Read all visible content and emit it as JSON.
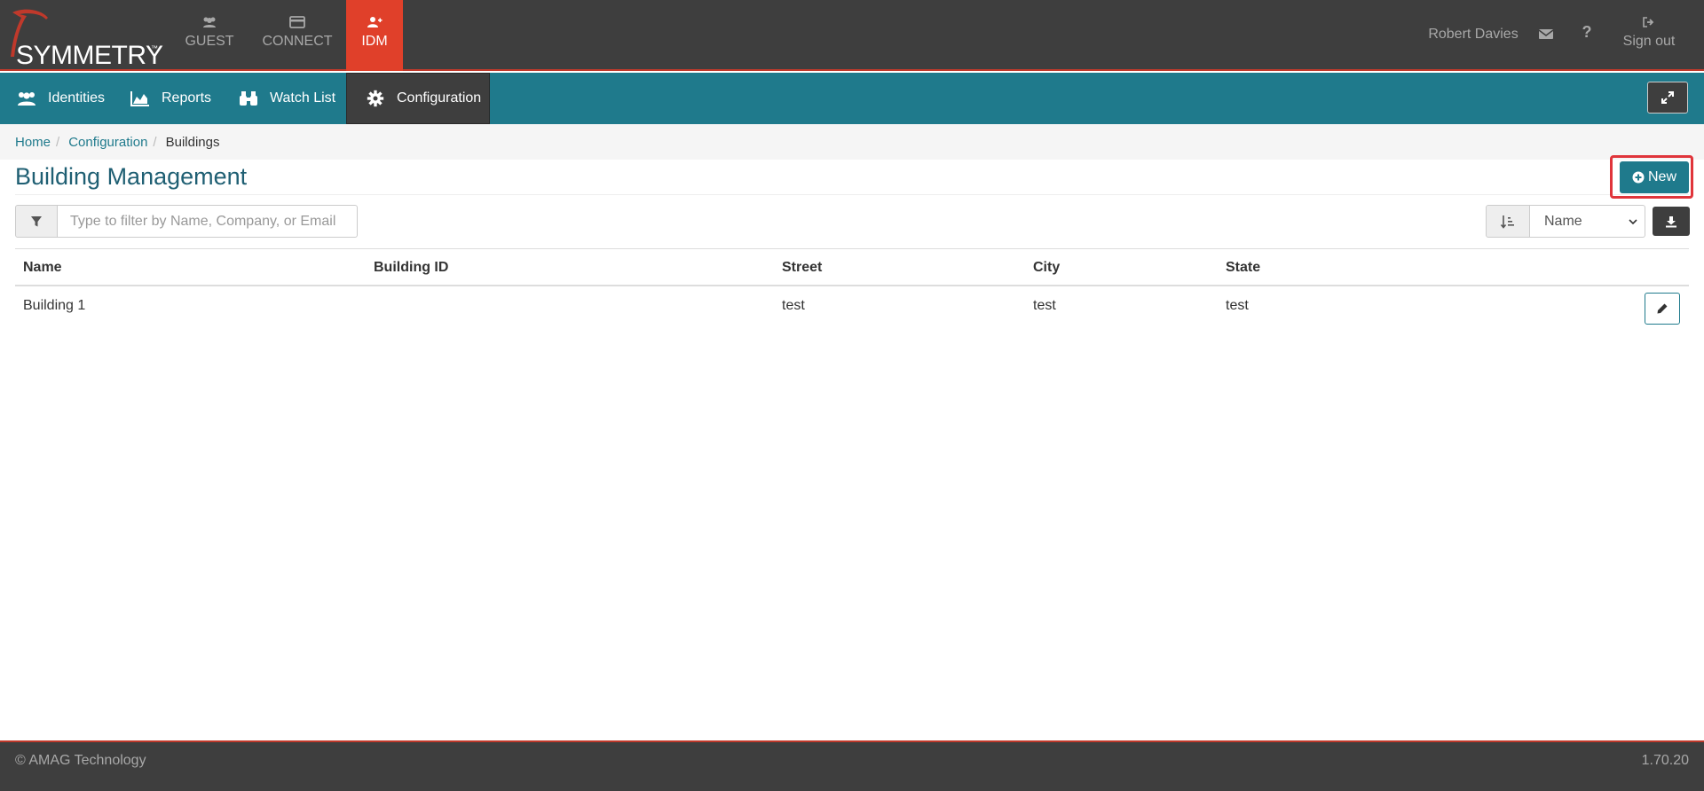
{
  "brand": {
    "name": "SYMMETRY",
    "tm": "™"
  },
  "app_tabs": [
    {
      "label": "GUEST",
      "icon": "users-icon",
      "active": false
    },
    {
      "label": "CONNECT",
      "icon": "card-icon",
      "active": false
    },
    {
      "label": "IDM",
      "icon": "user-plus-icon",
      "active": true
    }
  ],
  "user": {
    "name": "Robert Davies",
    "sign_out": "Sign out"
  },
  "nav": {
    "identities": "Identities",
    "reports": "Reports",
    "watch_list": "Watch List",
    "configuration": "Configuration"
  },
  "breadcrumb": {
    "home": "Home",
    "configuration": "Configuration",
    "current": "Buildings",
    "separator": "/"
  },
  "page": {
    "title": "Building Management",
    "new_button": "New"
  },
  "filter": {
    "placeholder": "Type to filter by Name, Company, or Email",
    "value": ""
  },
  "sort": {
    "selected": "Name"
  },
  "table": {
    "headers": [
      "Name",
      "Building ID",
      "Street",
      "City",
      "State"
    ],
    "rows": [
      {
        "name": "Building 1",
        "building_id": "",
        "street": "test",
        "city": "test",
        "state": "test"
      }
    ]
  },
  "footer": {
    "copyright": "© AMAG Technology",
    "version": "1.70.20"
  },
  "colors": {
    "topbar": "#3e3e3e",
    "accent_red": "#e0402a",
    "teal": "#1f7a8c",
    "highlight": "#e0353b"
  }
}
